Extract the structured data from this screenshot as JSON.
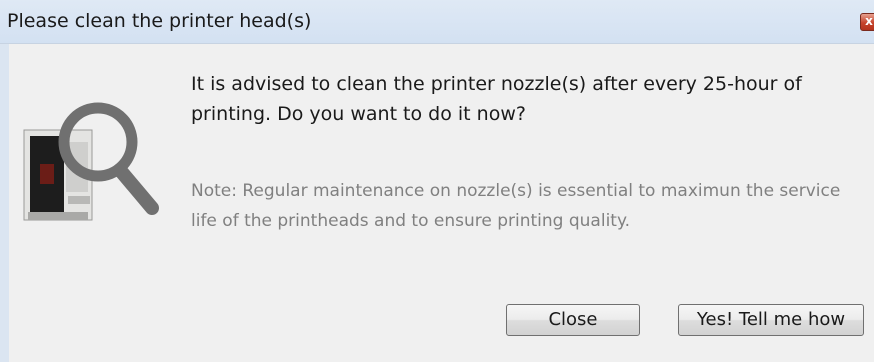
{
  "dialog": {
    "title": "Please clean the printer head(s)",
    "close_glyph": "x",
    "icon": "printer-magnifier-icon",
    "message": "It is advised to clean the printer nozzle(s) after every 25-hour of printing. Do you want to do it now?",
    "note": "Note: Regular maintenance on nozzle(s) is essential to maximun the service life of the printheads and to ensure printing quality.",
    "buttons": {
      "close_label": "Close",
      "yes_label": "Yes! Tell me how"
    }
  },
  "colors": {
    "titlebar": "#d3e1f2",
    "body": "#f0f0f0",
    "note_text": "#808080",
    "close_button": "#c6432c"
  }
}
